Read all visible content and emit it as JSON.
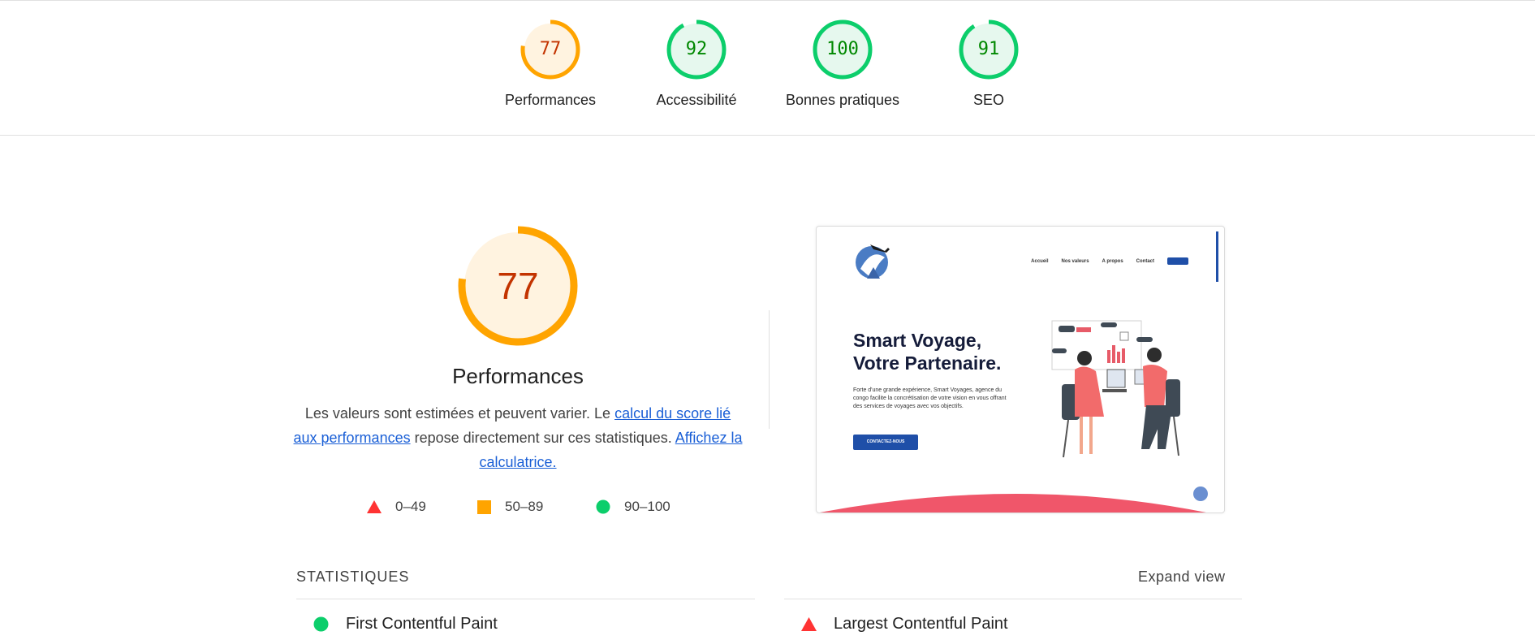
{
  "summary_gauges": [
    {
      "score": "77",
      "label": "Performances",
      "value": 0.77,
      "rating": "average"
    },
    {
      "score": "92",
      "label": "Accessibilité",
      "value": 0.92,
      "rating": "pass"
    },
    {
      "score": "100",
      "label": "Bonnes pratiques",
      "value": 1.0,
      "rating": "pass"
    },
    {
      "score": "91",
      "label": "SEO",
      "value": 0.91,
      "rating": "pass"
    }
  ],
  "performance": {
    "score": "77",
    "value": 0.77,
    "title": "Performances",
    "desc_part1": "Les valeurs sont estimées et peuvent varier. Le ",
    "desc_link1": "calcul du score lié aux performances",
    "desc_part2": " repose directement sur ces statistiques. ",
    "desc_link2": "Affichez la calculatrice."
  },
  "legend": [
    {
      "icon": "triangle-icon",
      "range": "0–49"
    },
    {
      "icon": "square-icon",
      "range": "50–89"
    },
    {
      "icon": "circle-icon",
      "range": "90–100"
    }
  ],
  "screenshot": {
    "nav": [
      "Accueil",
      "Nos valeurs",
      "A propos",
      "Contact"
    ],
    "hero_title_line1": "Smart Voyage,",
    "hero_title_line2": "Votre Partenaire.",
    "hero_text": "Forte d'une grande expérience, Smart Voyages, agence du congo facilite la concrétisation de votre vision en vous offrant des services de voyages avec vos objectifs.",
    "cta": "CONTACTEZ-NOUS"
  },
  "stats": {
    "heading": "STATISTIQUES",
    "expand": "Expand view",
    "metrics": [
      {
        "icon": "circle-icon",
        "label": "First Contentful Paint"
      },
      {
        "icon": "triangle-icon",
        "label": "Largest Contentful Paint"
      }
    ]
  },
  "colors": {
    "average_arc": "#ffa400",
    "average_fill": "#fff3e0",
    "average_text": "#c33300",
    "pass_arc": "#0cce6b",
    "pass_fill": "#e6f8ee",
    "pass_text": "#008800",
    "fail": "#ff3333",
    "link": "#1a5fd6"
  }
}
